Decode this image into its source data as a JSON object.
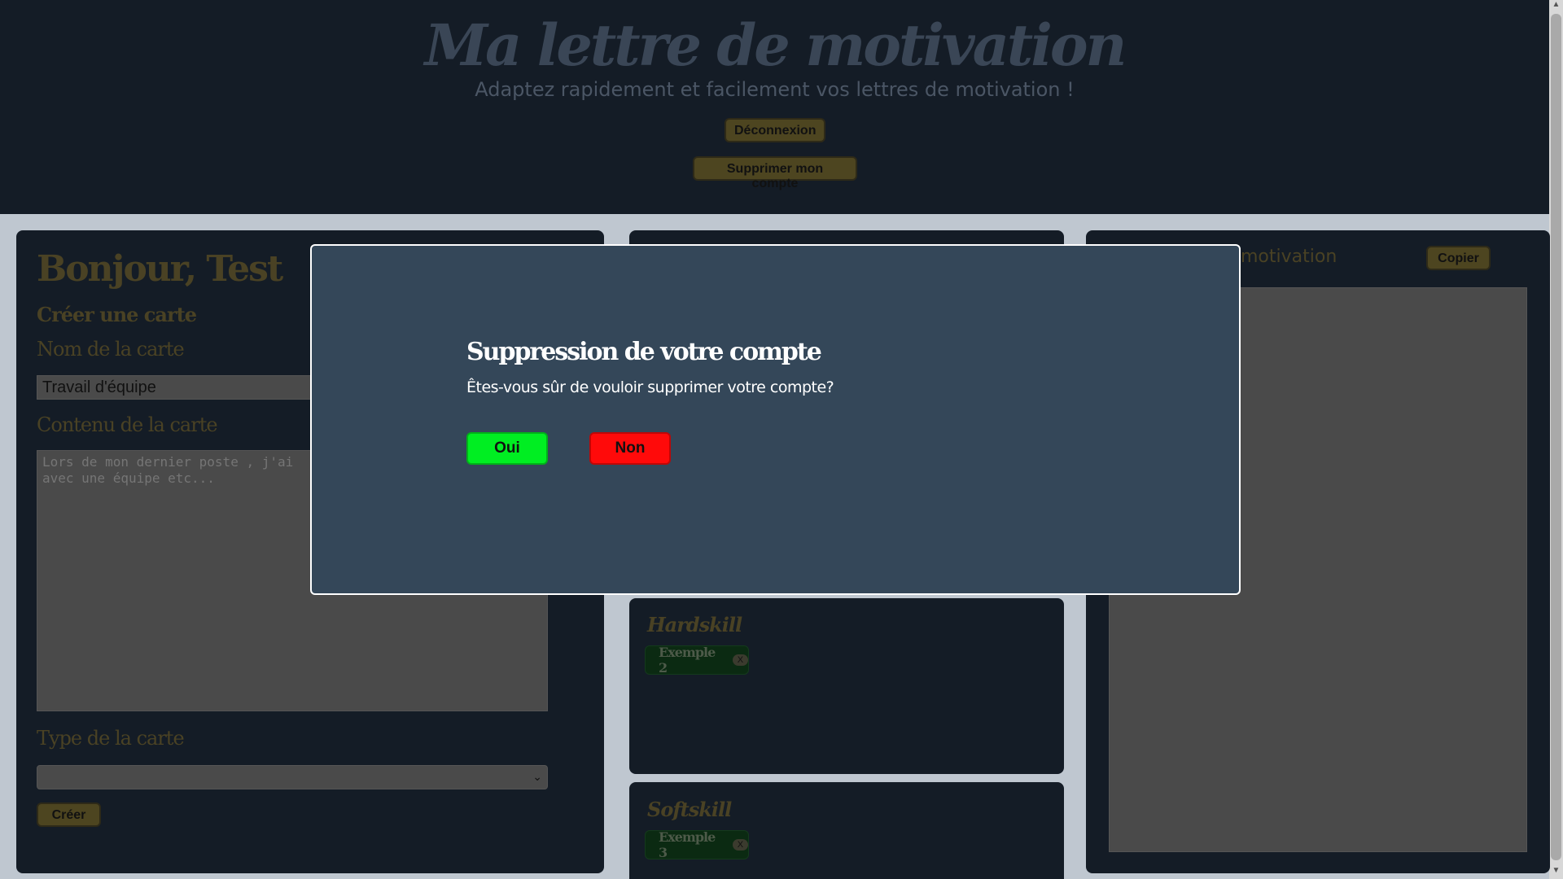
{
  "header": {
    "title": "Ma lettre de motivation",
    "subtitle": "Adaptez rapidement et facilement vos lettres de motivation !",
    "logout_label": "Déconnexion",
    "delete_account_label": "Supprimer mon compte"
  },
  "left_panel": {
    "greeting": "Bonjour, Test",
    "create_card_title": "Créer une carte",
    "card_name_label": "Nom de la carte",
    "card_name_value": "Travail d'équipe",
    "card_content_label": "Contenu de la carte",
    "card_content_placeholder": "Lors de mon dernier poste , j'ai\navec une équipe etc...",
    "card_type_label": "Type de la carte",
    "card_type_value": "",
    "create_label": "Créer"
  },
  "middle_panel": {
    "hardskill_label": "Hardskill",
    "hardskill_chip": "Exemple 2",
    "softskill_label": "Softskill",
    "softskill_chip": "Exemple 3",
    "chip_remove": "X"
  },
  "right_panel": {
    "title_visible": "motivation",
    "copy_label": "Copier"
  },
  "modal": {
    "title": "Suppression de votre compte",
    "question": "Êtes-vous sûr de vouloir supprimer votre compte?",
    "yes_label": "Oui",
    "no_label": "Non"
  },
  "colors": {
    "header_bg": "#141c26",
    "modal_bg": "#344759",
    "yes_green": "#00ee22",
    "no_red": "#ff0a0a"
  }
}
